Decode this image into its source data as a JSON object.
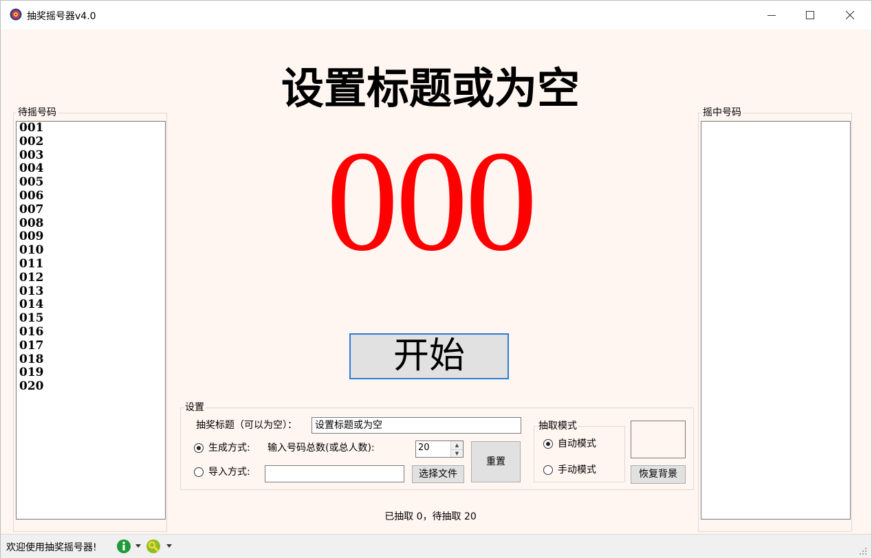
{
  "window": {
    "title": "抽奖摇号器v4.0"
  },
  "left_panel": {
    "legend": "待摇号码",
    "items": [
      "001",
      "002",
      "003",
      "004",
      "005",
      "006",
      "007",
      "008",
      "009",
      "010",
      "011",
      "012",
      "013",
      "014",
      "015",
      "016",
      "017",
      "018",
      "019",
      "020"
    ]
  },
  "right_panel": {
    "legend": "摇中号码",
    "items": []
  },
  "main": {
    "title": "设置标题或为空",
    "number": "000",
    "start_button": "开始",
    "status": "已抽取 0，待抽取 20"
  },
  "settings": {
    "legend": "设置",
    "title_label": "抽奖标题（可以为空）：",
    "title_value": "设置标题或为空",
    "generate_label": "生成方式:",
    "total_label": "输入号码总数(或总人数):",
    "total_value": "20",
    "import_label": "导入方式:",
    "import_value": "",
    "select_file_button": "选择文件",
    "reset_button": "重置",
    "mode_legend": "抽取模式",
    "auto_mode_label": "自动模式",
    "manual_mode_label": "手动模式",
    "restore_bg_button": "恢复背景"
  },
  "statusbar": {
    "text": "欢迎使用抽奖摇号器!"
  },
  "colors": {
    "number": "#ff0000",
    "accent_border": "#2b7bd4",
    "background": "#fff5f1"
  },
  "icons": {
    "app": "lottery-icon",
    "info": "info-icon",
    "tool": "tool-icon"
  }
}
